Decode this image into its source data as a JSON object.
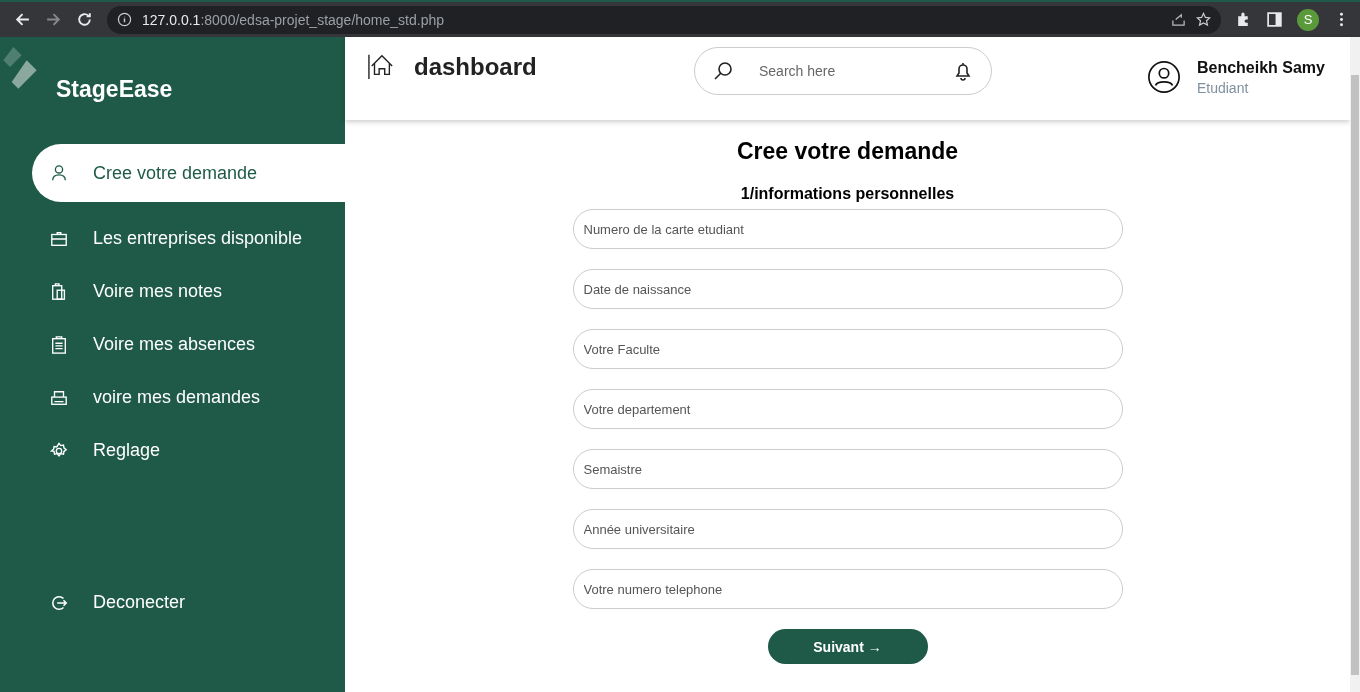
{
  "browser": {
    "url_host": "127.0.0.1",
    "url_path": ":8000/edsa-projet_stage/home_std.php",
    "profile_initial": "S"
  },
  "sidebar": {
    "brand": "StageEase",
    "items": [
      {
        "label": "Cree votre demande",
        "kind": "user",
        "selected": true
      },
      {
        "label": "Les entreprises disponible",
        "kind": "briefcase",
        "selected": false
      },
      {
        "label": "Voire mes notes",
        "kind": "clipboards",
        "selected": false
      },
      {
        "label": "Voire mes absences",
        "kind": "list",
        "selected": false
      },
      {
        "label": "voire mes demandes",
        "kind": "printer",
        "selected": false
      },
      {
        "label": "Reglage",
        "kind": "gear",
        "selected": false
      }
    ],
    "logout": {
      "label": "Deconecter"
    }
  },
  "header": {
    "title": "dashboard",
    "search": {
      "placeholder": "Search here"
    },
    "user": {
      "name": "Bencheikh Samy",
      "role": "Etudiant"
    }
  },
  "form": {
    "title": "Cree votre demande",
    "section": "1/informations personnelles",
    "fields": [
      {
        "placeholder": "Numero de la carte etudiant"
      },
      {
        "placeholder": "Date de naissance"
      },
      {
        "placeholder": "Votre Faculte"
      },
      {
        "placeholder": "Votre departement"
      },
      {
        "placeholder": "Semaistre"
      },
      {
        "placeholder": "Année universitaire"
      },
      {
        "placeholder": "Votre numero telephone"
      }
    ],
    "submit": "Suivant →"
  }
}
